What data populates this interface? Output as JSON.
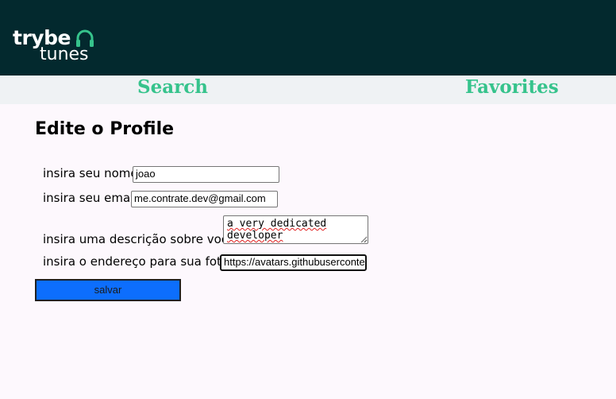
{
  "header": {
    "logo": {
      "line1": "trybe",
      "line2": "tunes",
      "icon": "headphones-icon"
    }
  },
  "nav": {
    "search_label": "Search",
    "favorites_label": "Favorites"
  },
  "main": {
    "title": "Edite o Profile",
    "form": {
      "name_label": "insira seu nome",
      "name_value": "joao",
      "email_label": "insira seu email",
      "email_value": "me.contrate.dev@gmail.com",
      "description_label": "insira uma descrição sobre você",
      "description_value": "a very dedicated developer",
      "photo_label": "insira o endereço para sua foto",
      "photo_value": "https://avatars.githubuserconte",
      "save_label": "salvar"
    }
  },
  "colors": {
    "header_bg": "#03292e",
    "nav_bg": "#eff2f4",
    "nav_link": "#36c38c",
    "page_bg": "#fdf8fd",
    "button_bg": "#0d6efd"
  }
}
